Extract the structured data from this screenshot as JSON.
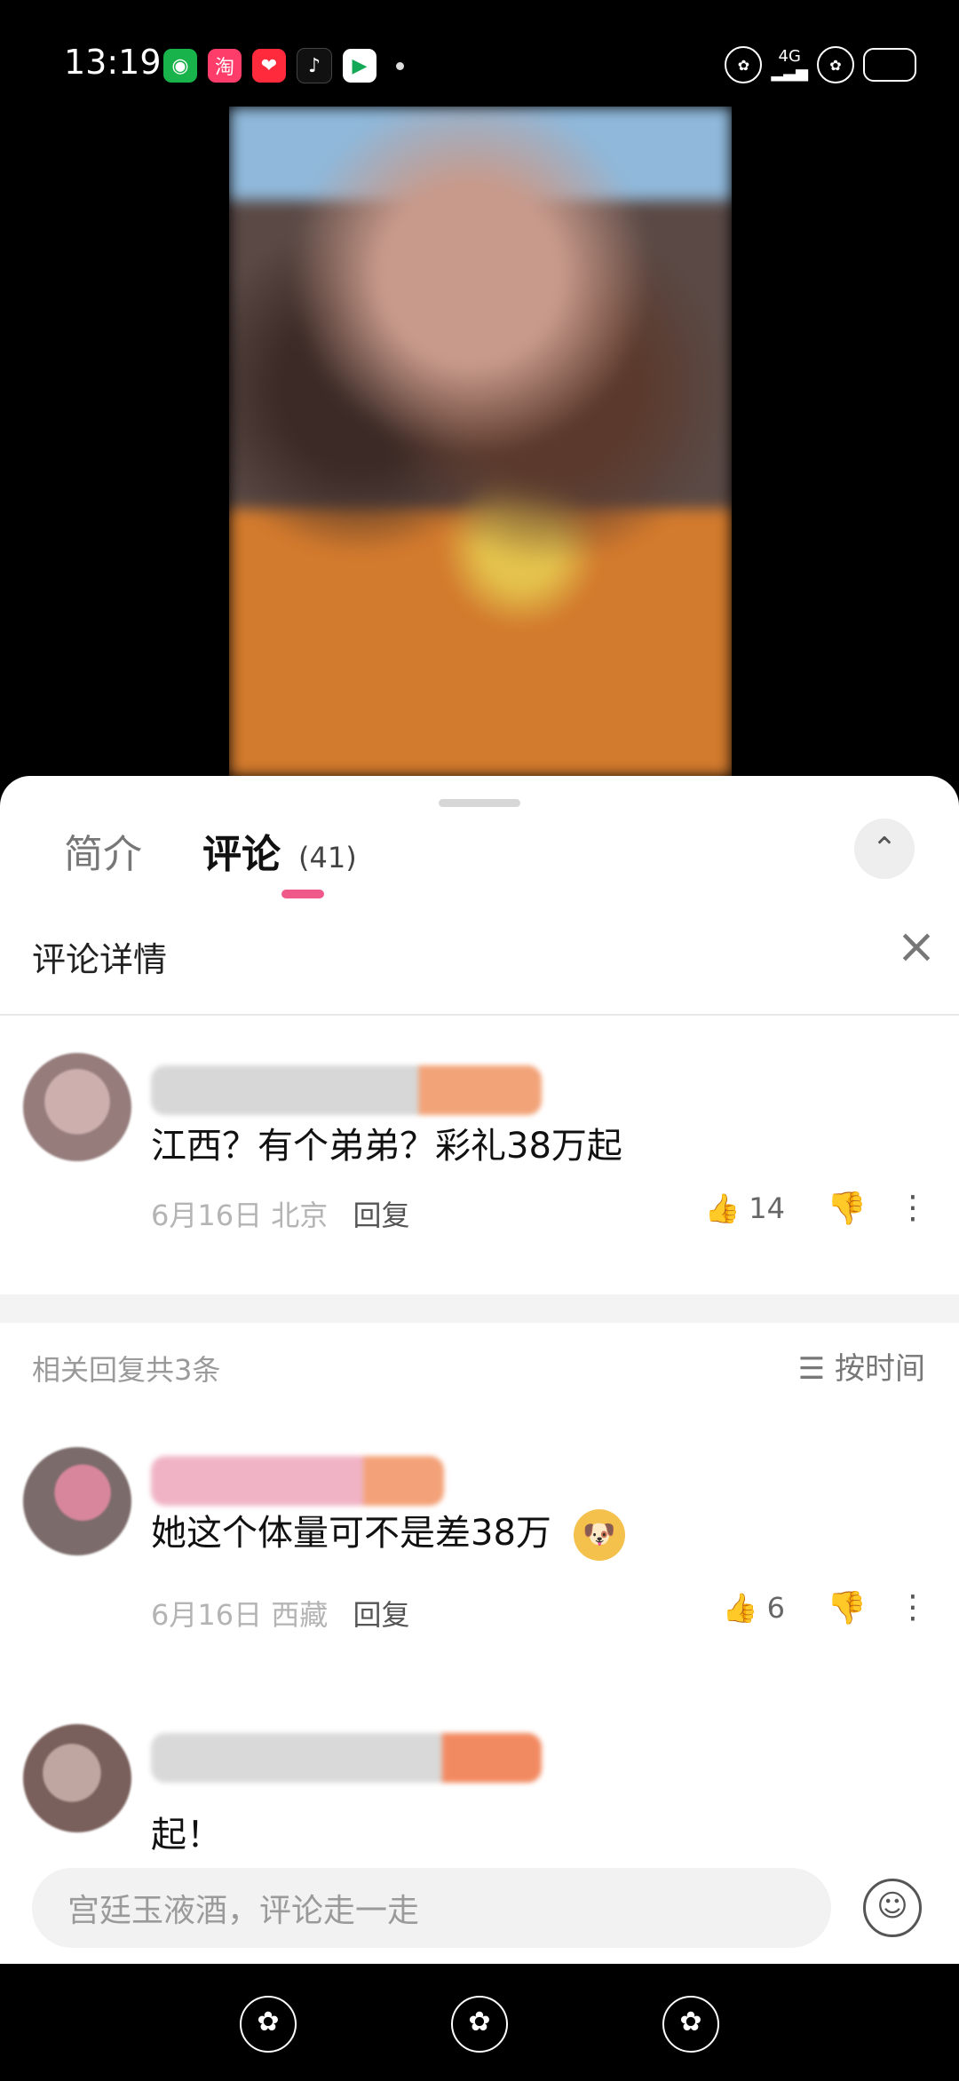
{
  "status_bar": {
    "time": "13:19",
    "network_type": "4G",
    "app_icons": [
      "wechat-icon",
      "taobao-icon",
      "red-heart-icon",
      "tiktok-icon",
      "video-icon"
    ]
  },
  "sheet": {
    "tabs": [
      {
        "label": "简介"
      },
      {
        "label": "评论",
        "count": "(41)"
      }
    ],
    "detail_title": "评论详情",
    "main_comment": {
      "text": "江西？有个弟弟？彩礼38万起",
      "date": "6月16日",
      "location": "北京",
      "reply_label": "回复",
      "likes": "14"
    },
    "replies_summary": "相关回复共3条",
    "sort_label": "按时间",
    "replies": [
      {
        "text": "她这个体量可不是差38万",
        "date": "6月16日",
        "location": "西藏",
        "reply_label": "回复",
        "likes": "6",
        "emoji": "🐶"
      },
      {
        "text": "起！"
      }
    ],
    "input_placeholder": "宫廷玉液酒，评论走一走"
  },
  "colors": {
    "accent": "#f05a8b",
    "background": "#ffffff",
    "muted_text": "#b4b4b4"
  }
}
